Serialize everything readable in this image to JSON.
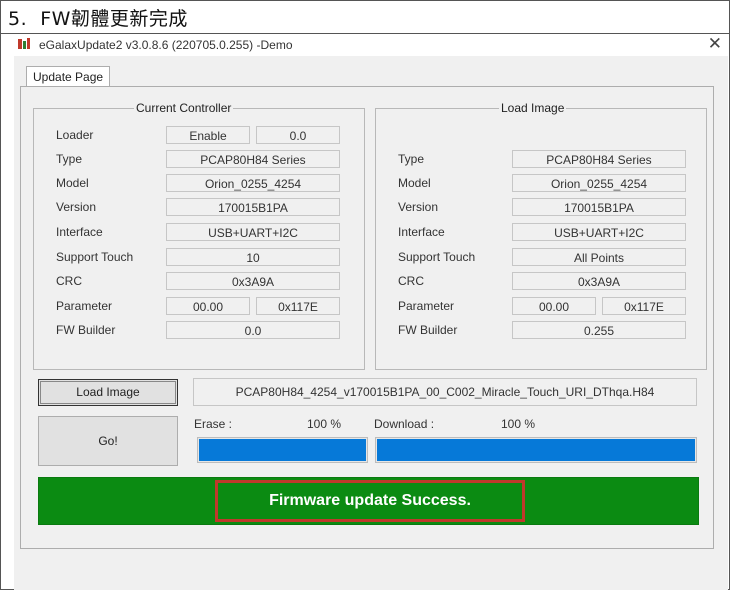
{
  "heading": "5.  FW韌體更新完成",
  "window": {
    "title": "eGalaxUpdate2 v3.0.8.6 (220705.0.255) -Demo",
    "close_glyph": "✕",
    "icon": "app-logo-icon"
  },
  "tab": {
    "label": "Update Page"
  },
  "current": {
    "title": "Current Controller",
    "loader_label": "Loader",
    "loader_state": "Enable",
    "loader_version": "0.0",
    "rows": [
      {
        "label": "Type",
        "value": "PCAP80H84 Series"
      },
      {
        "label": "Model",
        "value": "Orion_0255_4254"
      },
      {
        "label": "Version",
        "value": "170015B1PA"
      },
      {
        "label": "Interface",
        "value": "USB+UART+I2C"
      },
      {
        "label": "Support Touch",
        "value": "10"
      },
      {
        "label": "CRC",
        "value": "0x3A9A"
      }
    ],
    "parameter_label": "Parameter",
    "parameter_a": "00.00",
    "parameter_b": "0x117E",
    "fw_builder_label": "FW Builder",
    "fw_builder": "0.0"
  },
  "load": {
    "title": "Load Image",
    "rows": [
      {
        "label": "Type",
        "value": "PCAP80H84 Series"
      },
      {
        "label": "Model",
        "value": "Orion_0255_4254"
      },
      {
        "label": "Version",
        "value": "170015B1PA"
      },
      {
        "label": "Interface",
        "value": "USB+UART+I2C"
      },
      {
        "label": "Support Touch",
        "value": "All Points"
      },
      {
        "label": "CRC",
        "value": "0x3A9A"
      }
    ],
    "parameter_label": "Parameter",
    "parameter_a": "00.00",
    "parameter_b": "0x117E",
    "fw_builder_label": "FW Builder",
    "fw_builder": "0.255"
  },
  "actions": {
    "load_image_label": "Load Image",
    "go_label": "Go!",
    "image_path": "PCAP80H84_4254_v170015B1PA_00_C002_Miracle_Touch_URI_DThqa.H84"
  },
  "progress": {
    "erase_label": "Erase :",
    "erase_text": "100 %",
    "erase_fraction": 1.0,
    "download_label": "Download :",
    "download_text": "100 %",
    "download_fraction": 1.0
  },
  "status": {
    "message": "Firmware update Success.",
    "color": "#0b8b12"
  }
}
